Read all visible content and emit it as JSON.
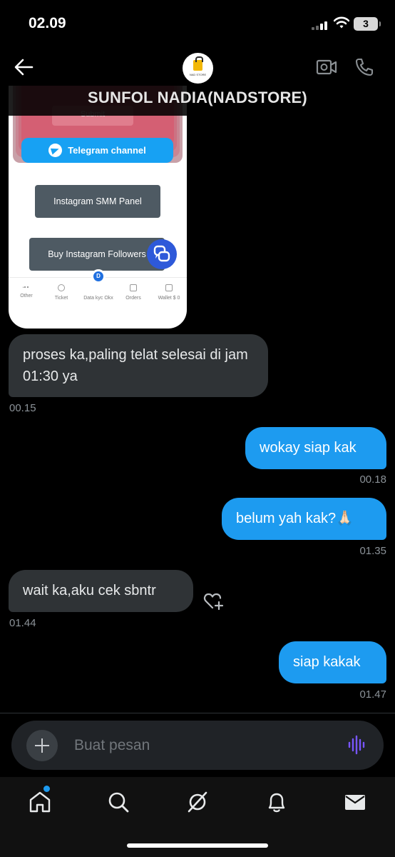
{
  "status_bar": {
    "time": "02.09",
    "battery": "3"
  },
  "header": {
    "title": "SUNFOL NADIA(NADSTORE)",
    "avatar_text": "NAD STORE"
  },
  "shared_image": {
    "submit_label": "Submit",
    "telegram_label": "Telegram channel",
    "smm_panel_label": "Instagram SMM Panel",
    "buy_followers_label": "Buy Instagram Followers",
    "tabs": [
      {
        "label": "Other"
      },
      {
        "label": "Ticket"
      },
      {
        "label": "Data kyc Okx",
        "badge": "D"
      },
      {
        "label": "Orders"
      },
      {
        "label": "Wallet $ 0"
      }
    ]
  },
  "messages": [
    {
      "direction": "incoming",
      "text": "proses ka,paling telat selesai di jam 01:30 ya",
      "time": "00.15"
    },
    {
      "direction": "outgoing",
      "text": "wokay siap kak",
      "time": "00.18"
    },
    {
      "direction": "outgoing",
      "text": "belum yah kak?🙏🏻",
      "time": "01.35"
    },
    {
      "direction": "incoming",
      "text": "wait ka,aku cek sbntr",
      "time": "01.44"
    },
    {
      "direction": "outgoing",
      "text": "siap kakak",
      "time": "01.47"
    }
  ],
  "composer": {
    "placeholder": "Buat pesan",
    "value": ""
  },
  "colors": {
    "accent": "#1d9bf0",
    "incoming_bubble": "#2f3336",
    "background": "#000000",
    "voice_icon": "#7856ff"
  },
  "icons": {
    "back": "arrow-left-icon",
    "video": "video-camera-icon",
    "call": "phone-icon",
    "react": "heart-plus-icon",
    "add": "plus-icon",
    "voice": "voice-wave-icon",
    "nav": [
      "home-icon",
      "search-icon",
      "grok-icon",
      "bell-icon",
      "mail-icon"
    ]
  }
}
